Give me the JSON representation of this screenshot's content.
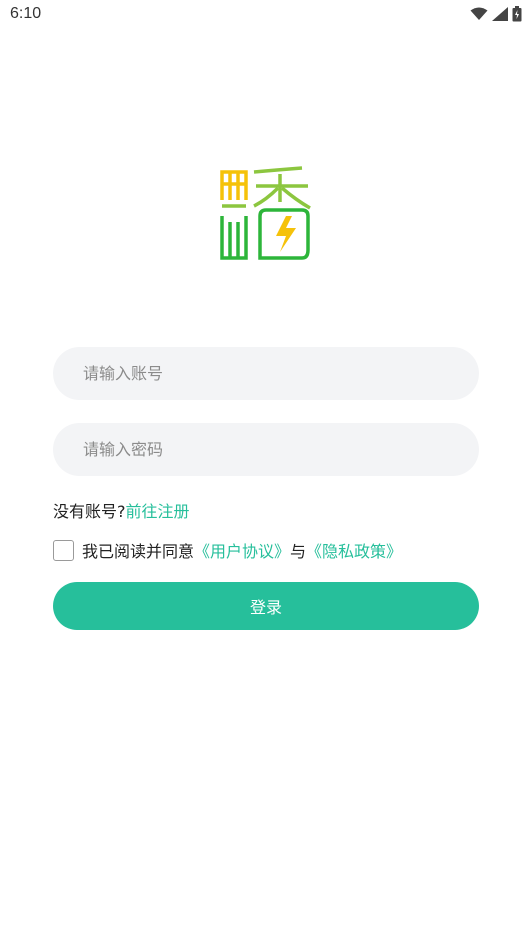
{
  "status_bar": {
    "time": "6:10",
    "icons": [
      "wifi-icon",
      "signal-icon",
      "battery-icon"
    ]
  },
  "logo": {
    "icon": "app-logo-icon"
  },
  "form": {
    "account_placeholder": "请输入账号",
    "password_placeholder": "请输入密码"
  },
  "register": {
    "prompt": "没有账号?",
    "link": "前往注册"
  },
  "agreement": {
    "prefix": "我已阅读并同意",
    "user_agreement": "《用户协议》",
    "conjunction": "与",
    "privacy_policy": "《隐私政策》",
    "checked": false
  },
  "login_button": {
    "label": "登录"
  },
  "colors": {
    "accent": "#26bf9b",
    "field_bg": "#f3f4f6",
    "logo_green": "#2db53a",
    "logo_yellow": "#f5c20a"
  }
}
